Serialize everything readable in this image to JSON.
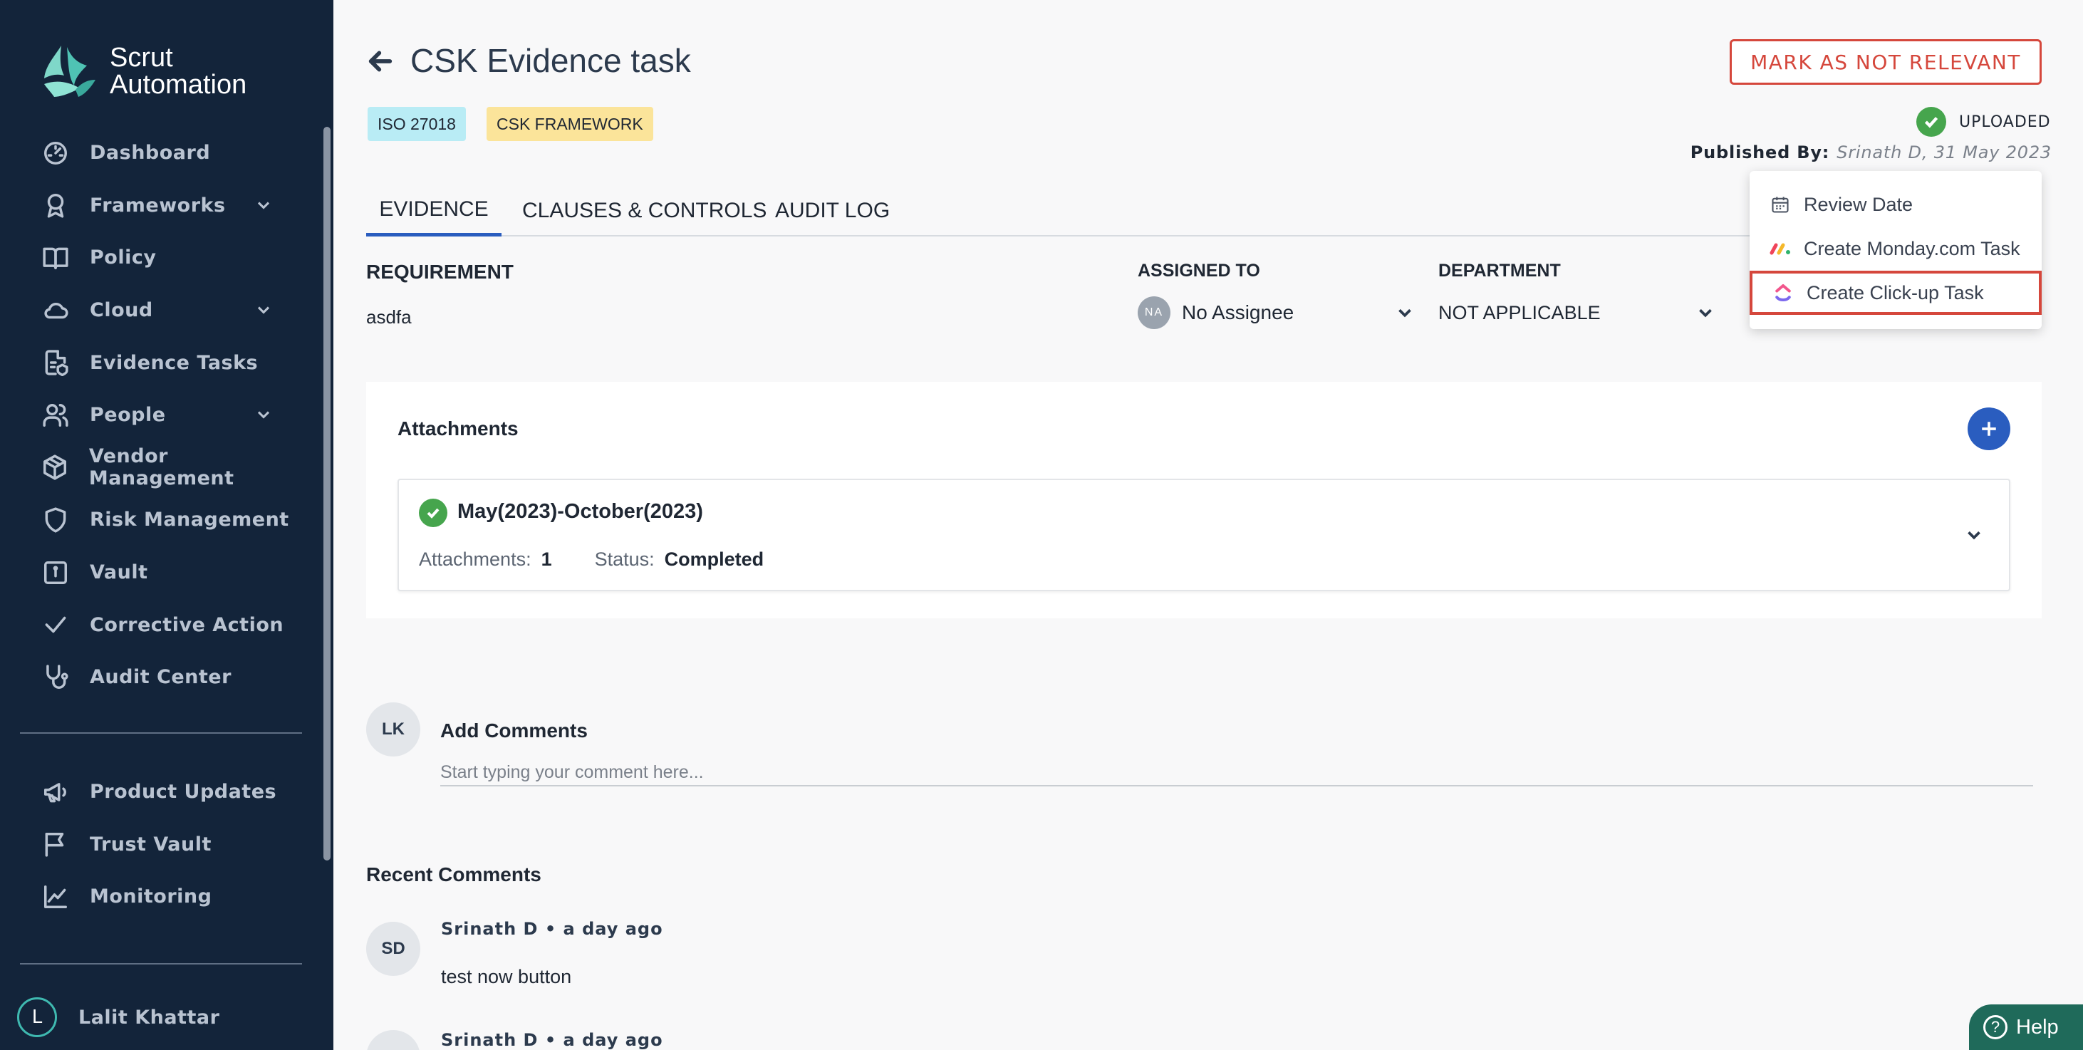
{
  "app": {
    "logo_line1": "Scrut",
    "logo_line2": "Automation",
    "brand_color": "#4fc3b4"
  },
  "sidebar": {
    "items": [
      {
        "label": "Dashboard",
        "icon": "dashboard-icon",
        "has_chevron": false
      },
      {
        "label": "Frameworks",
        "icon": "award-icon",
        "has_chevron": true
      },
      {
        "label": "Policy",
        "icon": "book-icon",
        "has_chevron": false
      },
      {
        "label": "Cloud",
        "icon": "cloud-icon",
        "has_chevron": true
      },
      {
        "label": "Evidence Tasks",
        "icon": "document-shield-icon",
        "has_chevron": false
      },
      {
        "label": "People",
        "icon": "people-icon",
        "has_chevron": true
      },
      {
        "label": "Vendor Management",
        "icon": "box-icon",
        "has_chevron": false
      },
      {
        "label": "Risk Management",
        "icon": "shield-icon",
        "has_chevron": false
      },
      {
        "label": "Vault",
        "icon": "vault-icon",
        "has_chevron": false
      },
      {
        "label": "Corrective Action",
        "icon": "check-icon",
        "has_chevron": false
      },
      {
        "label": "Audit Center",
        "icon": "stethoscope-icon",
        "has_chevron": false
      }
    ],
    "secondary_items": [
      {
        "label": "Product Updates",
        "icon": "megaphone-icon"
      },
      {
        "label": "Trust Vault",
        "icon": "flag-icon"
      },
      {
        "label": "Monitoring",
        "icon": "chart-line-icon"
      }
    ],
    "user": {
      "initial": "L",
      "name": "Lalit Khattar"
    }
  },
  "header": {
    "title": "CSK Evidence task",
    "chips": [
      "ISO 27018",
      "CSK FRAMEWORK"
    ],
    "mark_button": "MARK AS NOT RELEVANT",
    "status": "UPLOADED",
    "published_label": "Published By:",
    "published_value": "Srinath D, 31 May 2023"
  },
  "tabs": [
    {
      "label": "EVIDENCE",
      "active": true
    },
    {
      "label": "CLAUSES & CONTROLS",
      "active": false
    },
    {
      "label": "AUDIT LOG",
      "active": false
    }
  ],
  "requirement": {
    "label": "REQUIREMENT",
    "value": "asdfa"
  },
  "assigned_to": {
    "label": "ASSIGNED TO",
    "badge": "NA",
    "value": "No Assignee"
  },
  "department": {
    "label": "DEPARTMENT",
    "value": "NOT APPLICABLE"
  },
  "menu": {
    "items": [
      {
        "label": "Review Date",
        "icon": "calendar-icon"
      },
      {
        "label": "Create Monday.com Task",
        "icon": "monday-icon"
      },
      {
        "label": "Create Click-up Task",
        "icon": "clickup-icon",
        "highlighted": true
      }
    ]
  },
  "attachments": {
    "title": "Attachments",
    "row": {
      "name": "May(2023)-October(2023)",
      "attachments_label": "Attachments:",
      "attachments_count": "1",
      "status_label": "Status:",
      "status_value": "Completed"
    }
  },
  "comments": {
    "user_initials": "LK",
    "add_title": "Add Comments",
    "placeholder": "Start typing your comment here...",
    "recent_title": "Recent Comments",
    "list": [
      {
        "initials": "SD",
        "author": "Srinath D • a day ago",
        "text": "test now button"
      },
      {
        "initials": "",
        "author": "Srinath D • a day ago",
        "text": ""
      }
    ]
  },
  "help": {
    "label": "Help"
  }
}
